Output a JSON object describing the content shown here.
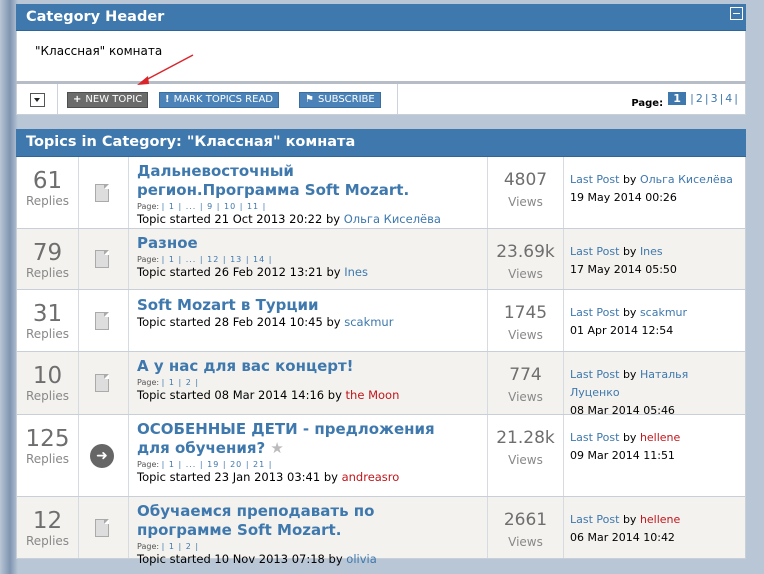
{
  "category_header": {
    "title": "Category Header",
    "description": "\"Классная\" комната"
  },
  "toolbar": {
    "new_topic": "New Topic",
    "new_topic_icon": "+",
    "mark_read": "Mark Topics Read",
    "mark_read_icon": "!",
    "subscribe": "Subscribe",
    "subscribe_icon": "⚑",
    "page_label": "Page:",
    "pages": [
      "1",
      "2",
      "3",
      "4"
    ],
    "current_page": "1"
  },
  "topics_header": {
    "title": "Topics in Category: \"Классная\" комната"
  },
  "labels": {
    "replies": "Replies",
    "views": "Views",
    "last_post": "Last Post",
    "by": "by",
    "page": "Page:",
    "started": "Topic started"
  },
  "colors": {
    "accent": "#3e78ad",
    "user_red": "#c0161b"
  },
  "topics": [
    {
      "replies": "61",
      "title_lines": [
        "Дальневосточный",
        "регион.Программа Soft Mozart."
      ],
      "pages": "| 1 | ... | 9 | 10 | 11 |",
      "started": "21 Oct 2013 20:22",
      "author": "Ольга Киселёва",
      "author_red": false,
      "views": "4807",
      "last_user": "Ольга Киселёва",
      "last_user_red": false,
      "last_user_lines": [
        "Ольга Киселёва"
      ],
      "last_date": "19 May 2014 00:26",
      "icon": "doc"
    },
    {
      "replies": "79",
      "title_lines": [
        "Разное"
      ],
      "pages": "| 1 | ... | 12 | 13 | 14 |",
      "started": "26 Feb 2012 13:21",
      "author": "Ines",
      "author_red": false,
      "views": "23.69k",
      "last_user": "Ines",
      "last_user_red": false,
      "last_user_lines": [
        "Ines"
      ],
      "last_date": "17 May 2014 05:50",
      "icon": "doc"
    },
    {
      "replies": "31",
      "title_lines": [
        "Soft Mozart в Турции"
      ],
      "pages": "",
      "started": "28 Feb 2014 10:45",
      "author": "scakmur",
      "author_red": false,
      "views": "1745",
      "last_user": "scakmur",
      "last_user_red": false,
      "last_user_lines": [
        "scakmur"
      ],
      "last_date": "01 Apr 2014 12:54",
      "icon": "doc"
    },
    {
      "replies": "10",
      "title_lines": [
        "А у нас для вас концерт!"
      ],
      "pages": "| 1 | 2 |",
      "started": "08 Mar 2014 14:16",
      "author": "the Moon",
      "author_red": true,
      "views": "774",
      "last_user": "Наталья Луценко",
      "last_user_red": false,
      "last_user_lines": [
        "Наталья",
        "Луценко"
      ],
      "last_date": "08 Mar 2014 05:46",
      "icon": "doc"
    },
    {
      "replies": "125",
      "title_lines": [
        "ОСОБЕННЫЕ ДЕТИ - предложения",
        "для обучения?"
      ],
      "pages": "| 1 | ... | 19 | 20 | 21 |",
      "started": "23 Jan 2013 03:41",
      "author": "andreasro",
      "author_red": true,
      "views": "21.28k",
      "last_user": "hellene",
      "last_user_red": true,
      "last_user_lines": [
        "hellene"
      ],
      "last_date": "09 Mar 2014 11:51",
      "icon": "hot",
      "star": true
    },
    {
      "replies": "12",
      "title_lines": [
        "Обучаемся преподавать по",
        "программе Soft Mozart."
      ],
      "pages": "| 1 | 2 |",
      "started": "10 Nov 2013 07:18",
      "author": "olivia",
      "author_red": false,
      "views": "2661",
      "last_user": "hellene",
      "last_user_red": true,
      "last_user_lines": [
        "hellene"
      ],
      "last_date": "06 Mar 2014 10:42",
      "icon": "doc"
    }
  ]
}
